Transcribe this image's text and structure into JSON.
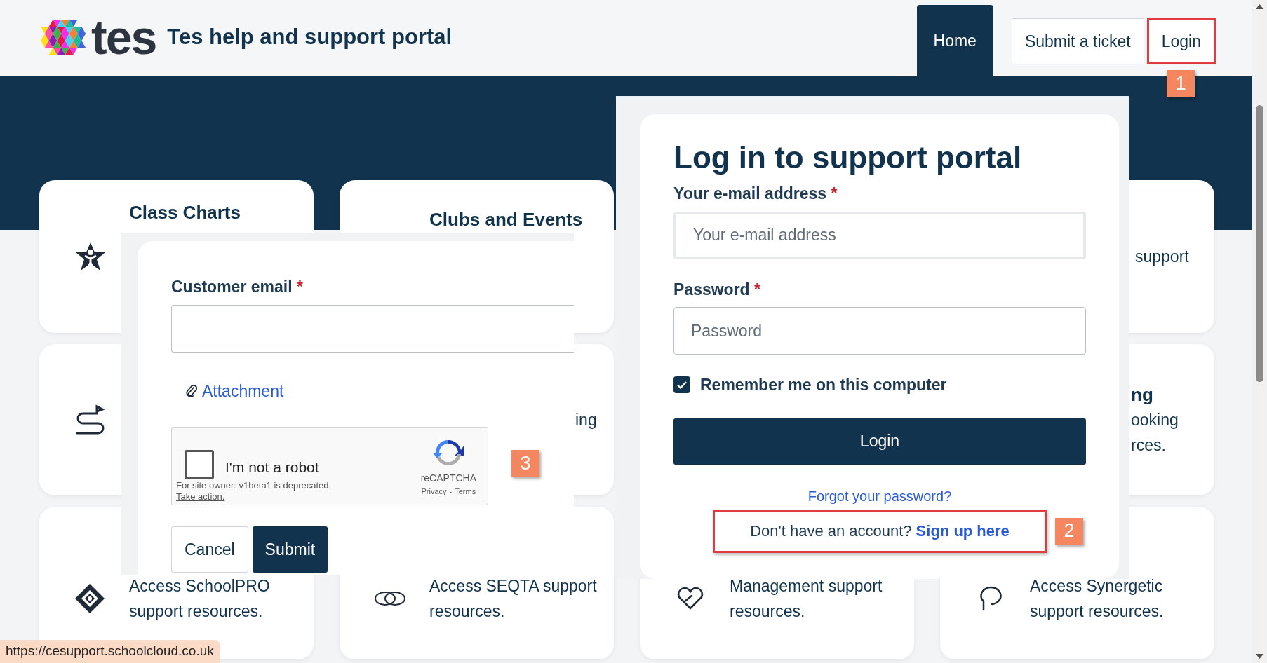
{
  "header": {
    "logo_text": "tes",
    "title": "Tes help and support portal",
    "nav": [
      {
        "label": "Home",
        "selected": true,
        "outlined": false
      },
      {
        "label": "Submit a ticket",
        "selected": false,
        "outlined": false
      },
      {
        "label": "Login",
        "selected": false,
        "outlined": true,
        "callout": "1"
      }
    ]
  },
  "cards": [
    {
      "kind": "heading",
      "lines": [
        {
          "text": "Class Charts",
          "bold": true
        }
      ]
    },
    {
      "kind": "heading",
      "lines": [
        {
          "text": "Clubs and Events",
          "bold": true
        }
      ]
    },
    {
      "kind": "fragment",
      "lines": [
        {
          "text": "support",
          "bold": false
        }
      ]
    },
    {
      "kind": "icon_only"
    },
    {
      "kind": "fragment",
      "lines": [
        {
          "text": "ing",
          "bold": false
        }
      ]
    },
    {
      "kind": "fragment",
      "lines": [
        {
          "text": "ng",
          "bold": true
        },
        {
          "text": "ooking",
          "bold": false
        },
        {
          "text": "rces.",
          "bold": false
        }
      ]
    },
    {
      "kind": "body",
      "lines": [
        {
          "text": "Access SchoolPRO",
          "bold": false
        },
        {
          "text": "support resources.",
          "bold": false
        }
      ]
    },
    {
      "kind": "body",
      "lines": [
        {
          "text": "Access SEQTA support",
          "bold": false
        },
        {
          "text": "resources.",
          "bold": false
        }
      ]
    },
    {
      "kind": "body",
      "lines": [
        {
          "text": "Management support",
          "bold": false
        },
        {
          "text": "resources.",
          "bold": false
        }
      ]
    },
    {
      "kind": "body",
      "lines": [
        {
          "text": "Access Synergetic",
          "bold": false
        },
        {
          "text": "support resources.",
          "bold": false
        }
      ]
    }
  ],
  "ticket_form": {
    "email_label": "Customer email",
    "required_mark": "*",
    "attachment": "Attachment",
    "captcha": {
      "checked": false,
      "label": "I'm not a robot",
      "notice": "For site owner: v1beta1 is deprecated.",
      "notice_link": "Take action.",
      "brand": "reCAPTCHA",
      "links": [
        "Privacy",
        "Terms"
      ],
      "separator": "-",
      "callout": "3"
    },
    "buttons": [
      {
        "label": "Cancel",
        "kind": "secondary"
      },
      {
        "label": "Submit",
        "kind": "primary"
      }
    ]
  },
  "login_form": {
    "title": "Log in to support portal",
    "fields": [
      {
        "label": "Your e-mail address",
        "required_mark": "*",
        "placeholder": "Your e-mail address",
        "focused": true
      },
      {
        "label": "Password",
        "required_mark": "*",
        "placeholder": "Password",
        "focused": false
      }
    ],
    "remember": {
      "label": "Remember me on this computer",
      "checked": true
    },
    "button": "Login",
    "forgot_link": "Forgot your password?",
    "signup": {
      "text": "Don't have an account?",
      "link": "Sign up here",
      "outlined": true,
      "callout": "2"
    }
  },
  "status_url": "https://cesupport.schoolcloud.co.uk"
}
